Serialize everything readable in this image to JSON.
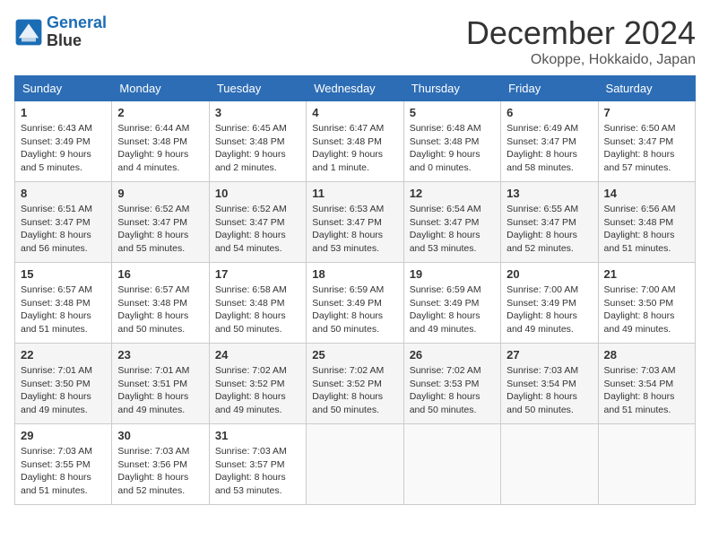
{
  "header": {
    "logo_line1": "General",
    "logo_line2": "Blue",
    "title": "December 2024",
    "subtitle": "Okoppe, Hokkaido, Japan"
  },
  "weekdays": [
    "Sunday",
    "Monday",
    "Tuesday",
    "Wednesday",
    "Thursday",
    "Friday",
    "Saturday"
  ],
  "weeks": [
    [
      {
        "day": "1",
        "info": "Sunrise: 6:43 AM\nSunset: 3:49 PM\nDaylight: 9 hours\nand 5 minutes."
      },
      {
        "day": "2",
        "info": "Sunrise: 6:44 AM\nSunset: 3:48 PM\nDaylight: 9 hours\nand 4 minutes."
      },
      {
        "day": "3",
        "info": "Sunrise: 6:45 AM\nSunset: 3:48 PM\nDaylight: 9 hours\nand 2 minutes."
      },
      {
        "day": "4",
        "info": "Sunrise: 6:47 AM\nSunset: 3:48 PM\nDaylight: 9 hours\nand 1 minute."
      },
      {
        "day": "5",
        "info": "Sunrise: 6:48 AM\nSunset: 3:48 PM\nDaylight: 9 hours\nand 0 minutes."
      },
      {
        "day": "6",
        "info": "Sunrise: 6:49 AM\nSunset: 3:47 PM\nDaylight: 8 hours\nand 58 minutes."
      },
      {
        "day": "7",
        "info": "Sunrise: 6:50 AM\nSunset: 3:47 PM\nDaylight: 8 hours\nand 57 minutes."
      }
    ],
    [
      {
        "day": "8",
        "info": "Sunrise: 6:51 AM\nSunset: 3:47 PM\nDaylight: 8 hours\nand 56 minutes."
      },
      {
        "day": "9",
        "info": "Sunrise: 6:52 AM\nSunset: 3:47 PM\nDaylight: 8 hours\nand 55 minutes."
      },
      {
        "day": "10",
        "info": "Sunrise: 6:52 AM\nSunset: 3:47 PM\nDaylight: 8 hours\nand 54 minutes."
      },
      {
        "day": "11",
        "info": "Sunrise: 6:53 AM\nSunset: 3:47 PM\nDaylight: 8 hours\nand 53 minutes."
      },
      {
        "day": "12",
        "info": "Sunrise: 6:54 AM\nSunset: 3:47 PM\nDaylight: 8 hours\nand 53 minutes."
      },
      {
        "day": "13",
        "info": "Sunrise: 6:55 AM\nSunset: 3:47 PM\nDaylight: 8 hours\nand 52 minutes."
      },
      {
        "day": "14",
        "info": "Sunrise: 6:56 AM\nSunset: 3:48 PM\nDaylight: 8 hours\nand 51 minutes."
      }
    ],
    [
      {
        "day": "15",
        "info": "Sunrise: 6:57 AM\nSunset: 3:48 PM\nDaylight: 8 hours\nand 51 minutes."
      },
      {
        "day": "16",
        "info": "Sunrise: 6:57 AM\nSunset: 3:48 PM\nDaylight: 8 hours\nand 50 minutes."
      },
      {
        "day": "17",
        "info": "Sunrise: 6:58 AM\nSunset: 3:48 PM\nDaylight: 8 hours\nand 50 minutes."
      },
      {
        "day": "18",
        "info": "Sunrise: 6:59 AM\nSunset: 3:49 PM\nDaylight: 8 hours\nand 50 minutes."
      },
      {
        "day": "19",
        "info": "Sunrise: 6:59 AM\nSunset: 3:49 PM\nDaylight: 8 hours\nand 49 minutes."
      },
      {
        "day": "20",
        "info": "Sunrise: 7:00 AM\nSunset: 3:49 PM\nDaylight: 8 hours\nand 49 minutes."
      },
      {
        "day": "21",
        "info": "Sunrise: 7:00 AM\nSunset: 3:50 PM\nDaylight: 8 hours\nand 49 minutes."
      }
    ],
    [
      {
        "day": "22",
        "info": "Sunrise: 7:01 AM\nSunset: 3:50 PM\nDaylight: 8 hours\nand 49 minutes."
      },
      {
        "day": "23",
        "info": "Sunrise: 7:01 AM\nSunset: 3:51 PM\nDaylight: 8 hours\nand 49 minutes."
      },
      {
        "day": "24",
        "info": "Sunrise: 7:02 AM\nSunset: 3:52 PM\nDaylight: 8 hours\nand 49 minutes."
      },
      {
        "day": "25",
        "info": "Sunrise: 7:02 AM\nSunset: 3:52 PM\nDaylight: 8 hours\nand 50 minutes."
      },
      {
        "day": "26",
        "info": "Sunrise: 7:02 AM\nSunset: 3:53 PM\nDaylight: 8 hours\nand 50 minutes."
      },
      {
        "day": "27",
        "info": "Sunrise: 7:03 AM\nSunset: 3:54 PM\nDaylight: 8 hours\nand 50 minutes."
      },
      {
        "day": "28",
        "info": "Sunrise: 7:03 AM\nSunset: 3:54 PM\nDaylight: 8 hours\nand 51 minutes."
      }
    ],
    [
      {
        "day": "29",
        "info": "Sunrise: 7:03 AM\nSunset: 3:55 PM\nDaylight: 8 hours\nand 51 minutes."
      },
      {
        "day": "30",
        "info": "Sunrise: 7:03 AM\nSunset: 3:56 PM\nDaylight: 8 hours\nand 52 minutes."
      },
      {
        "day": "31",
        "info": "Sunrise: 7:03 AM\nSunset: 3:57 PM\nDaylight: 8 hours\nand 53 minutes."
      },
      null,
      null,
      null,
      null
    ]
  ]
}
